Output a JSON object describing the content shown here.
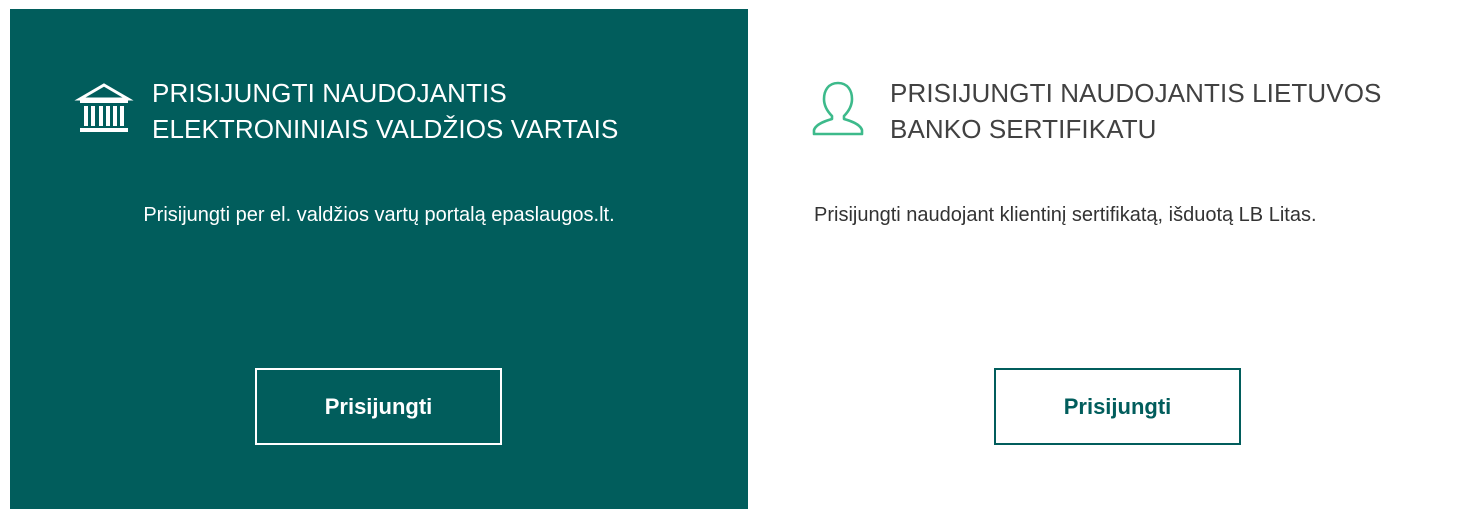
{
  "colors": {
    "accent": "#015d5c",
    "icon_green": "#3dba8b",
    "white": "#ffffff",
    "text_dark": "#333333"
  },
  "cards": [
    {
      "icon": "government-building-icon",
      "title": "PRISIJUNGTI NAUDOJANTIS ELEKTRONINIAIS VALDŽIOS VARTAIS",
      "description": "Prisijungti per el. valdžios vartų portalą epaslaugos.lt.",
      "button_label": "Prisijungti"
    },
    {
      "icon": "user-icon",
      "title": "PRISIJUNGTI NAUDOJANTIS LIETUVOS BANKO SERTIFIKATU",
      "description": "Prisijungti naudojant klientinį sertifikatą, išduotą LB Litas.",
      "button_label": "Prisijungti"
    }
  ]
}
